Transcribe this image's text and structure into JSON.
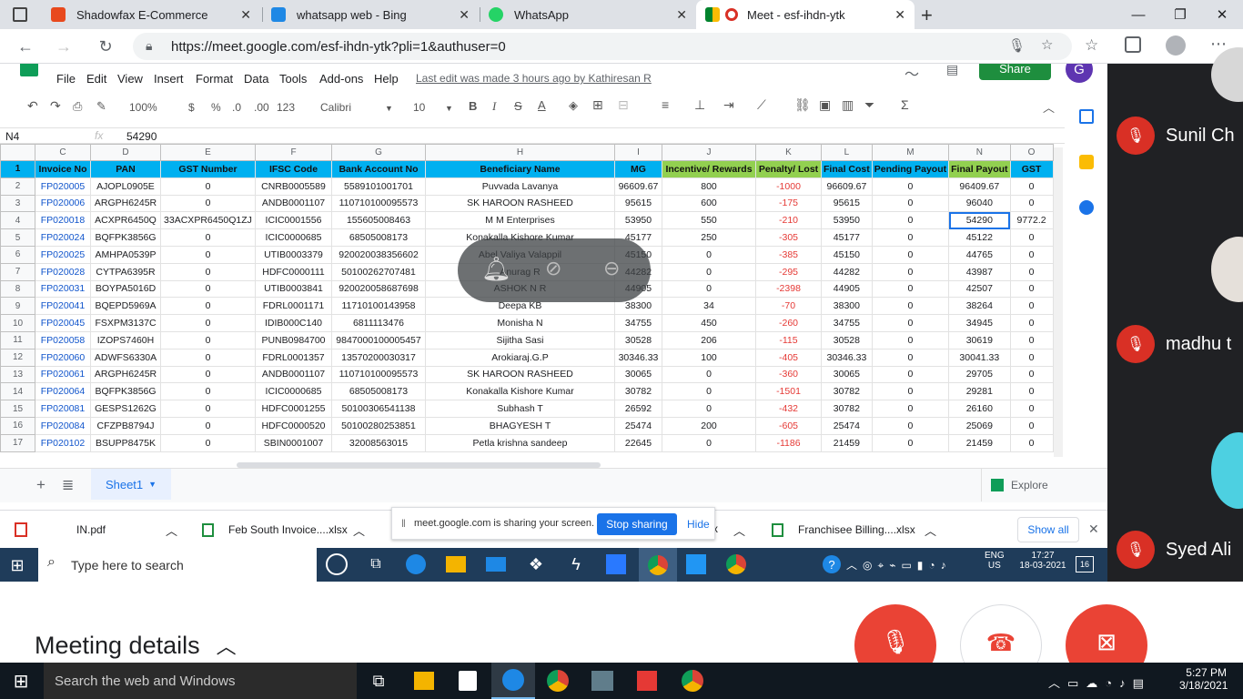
{
  "browser": {
    "tabs": [
      {
        "label": "Shadowfax E-Commerce"
      },
      {
        "label": "whatsapp web - Bing"
      },
      {
        "label": "WhatsApp"
      },
      {
        "label": "Meet - esf-ihdn-ytk"
      }
    ],
    "url": "https://meet.google.com/esf-ihdn-ytk?pli=1&authuser=0"
  },
  "sheet": {
    "menu": [
      "File",
      "Edit",
      "View",
      "Insert",
      "Format",
      "Data",
      "Tools",
      "Add-ons",
      "Help"
    ],
    "last_edit": "Last edit was made 3 hours ago by Kathiresan R",
    "share_label": "Share",
    "avatar_letter": "G",
    "toolbar": {
      "zoom": "100%",
      "currency": "$",
      "percent": "%",
      "dec_less": ".0",
      "dec_more": ".00",
      "format_123": "123",
      "font": "Calibri",
      "size": "10"
    },
    "cell_ref": "N4",
    "formula_value": "54290",
    "column_letters": [
      "C",
      "D",
      "E",
      "F",
      "G",
      "H",
      "I",
      "J",
      "K",
      "L",
      "M",
      "N",
      "O"
    ],
    "headers": [
      "Invoice No",
      "PAN",
      "GST Number",
      "IFSC Code",
      "Bank Account No",
      "Beneficiary Name",
      "MG",
      "Incentive/ Rewards",
      "Penalty/ Lost",
      "Final Cost",
      "Pending Payout",
      "Final Payout",
      "GST"
    ],
    "rows": [
      [
        "FP020005",
        "AJOPL0905E",
        "0",
        "CNRB0005589",
        "5589101001701",
        "Puvvada Lavanya",
        "96609.67",
        "800",
        "-1000",
        "96609.67",
        "0",
        "96409.67",
        "0"
      ],
      [
        "FP020006",
        "ARGPH6245R",
        "0",
        "ANDB0001107",
        "110710100095573",
        "SK HAROON RASHEED",
        "95615",
        "600",
        "-175",
        "95615",
        "0",
        "96040",
        "0"
      ],
      [
        "FP020018",
        "ACXPR6450Q",
        "33ACXPR6450Q1ZJ",
        "ICIC0001556",
        "155605008463",
        "M M Enterprises",
        "53950",
        "550",
        "-210",
        "53950",
        "0",
        "54290",
        "9772.2"
      ],
      [
        "FP020024",
        "BQFPK3856G",
        "0",
        "ICIC0000685",
        "68505008173",
        "Konakalla Kishore Kumar",
        "45177",
        "250",
        "-305",
        "45177",
        "0",
        "45122",
        "0"
      ],
      [
        "FP020025",
        "AMHPA0539P",
        "0",
        "UTIB0003379",
        "920020038356602",
        "Abel Valiya Valappil",
        "45150",
        "0",
        "-385",
        "45150",
        "0",
        "44765",
        "0"
      ],
      [
        "FP020028",
        "CYTPA6395R",
        "0",
        "HDFC0000111",
        "50100262707481",
        "Anurag R",
        "44282",
        "0",
        "-295",
        "44282",
        "0",
        "43987",
        "0"
      ],
      [
        "FP020031",
        "BOYPA5016D",
        "0",
        "UTIB0003841",
        "920020058687698",
        "ASHOK N R",
        "44905",
        "0",
        "-2398",
        "44905",
        "0",
        "42507",
        "0"
      ],
      [
        "FP020041",
        "BQEPD5969A",
        "0",
        "FDRL0001171",
        "11710100143958",
        "Deepa KB",
        "38300",
        "34",
        "-70",
        "38300",
        "0",
        "38264",
        "0"
      ],
      [
        "FP020045",
        "FSXPM3137C",
        "0",
        "IDIB000C140",
        "6811113476",
        "Monisha N",
        "34755",
        "450",
        "-260",
        "34755",
        "0",
        "34945",
        "0"
      ],
      [
        "FP020058",
        "IZOPS7460H",
        "0",
        "PUNB0984700",
        "9847000100005457",
        "Sijitha Sasi",
        "30528",
        "206",
        "-115",
        "30528",
        "0",
        "30619",
        "0"
      ],
      [
        "FP020060",
        "ADWFS6330A",
        "0",
        "FDRL0001357",
        "13570200030317",
        "Arokiaraj.G.P",
        "30346.33",
        "100",
        "-405",
        "30346.33",
        "0",
        "30041.33",
        "0"
      ],
      [
        "FP020061",
        "ARGPH6245R",
        "0",
        "ANDB0001107",
        "110710100095573",
        "SK HAROON RASHEED",
        "30065",
        "0",
        "-360",
        "30065",
        "0",
        "29705",
        "0"
      ],
      [
        "FP020064",
        "BQFPK3856G",
        "0",
        "ICIC0000685",
        "68505008173",
        "Konakalla Kishore Kumar",
        "30782",
        "0",
        "-1501",
        "30782",
        "0",
        "29281",
        "0"
      ],
      [
        "FP020081",
        "GESPS1262G",
        "0",
        "HDFC0001255",
        "50100306541138",
        "Subhash T",
        "26592",
        "0",
        "-432",
        "30782",
        "0",
        "26160",
        "0"
      ],
      [
        "FP020084",
        "CFZPB8794J",
        "0",
        "HDFC0000520",
        "50100280253851",
        "BHAGYESH T",
        "25474",
        "200",
        "-605",
        "25474",
        "0",
        "25069",
        "0"
      ],
      [
        "FP020102",
        "BSUPP8475K",
        "0",
        "SBIN0001007",
        "32008563015",
        "Petla krishna sandeep",
        "22645",
        "0",
        "-1186",
        "21459",
        "0",
        "21459",
        "0"
      ]
    ],
    "row_numbers": [
      "1",
      "2",
      "3",
      "4",
      "5",
      "6",
      "7",
      "8",
      "9",
      "10",
      "11",
      "12",
      "13",
      "14",
      "15",
      "16",
      "17"
    ],
    "sheet_tab": "Sheet1",
    "explore_label": "Explore"
  },
  "downloads": {
    "items": [
      "IN.pdf",
      "Feb South Invoice....xlsx",
      "Franchisee Billing....xlsx"
    ],
    "sharing_text": "meet.google.com is sharing your screen.",
    "stop_label": "Stop sharing",
    "hide_label": "Hide",
    "show_all": "Show all"
  },
  "taskbar_inner": {
    "search_placeholder": "Type here to search",
    "lang_top": "ENG",
    "lang_bottom": "US",
    "time": "17:27",
    "date": "18-03-2021",
    "notif_count": "16"
  },
  "meet": {
    "participants": [
      "Sunil Ch",
      "madhu t",
      "Syed Ali"
    ],
    "details_label": "Meeting details"
  },
  "taskbar_outer": {
    "search_placeholder": "Search the web and Windows",
    "time": "5:27 PM",
    "date": "3/18/2021"
  }
}
